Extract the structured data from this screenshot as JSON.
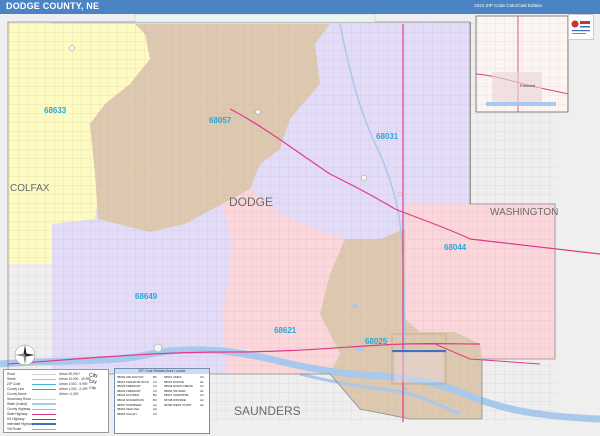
{
  "header": {
    "title": "DODGE COUNTY, NE",
    "edition": "2022 ZIP Code ColorCast Edition"
  },
  "map": {
    "county_label": "DODGE",
    "neighbor_counties": [
      "COLFAX",
      "WASHINGTON",
      "SAUNDERS"
    ],
    "zip_codes": [
      {
        "zip": "68633",
        "color": "#fdfbc2"
      },
      {
        "zip": "68057",
        "color": "#ddc8b0"
      },
      {
        "zip": "68031",
        "color": "#e2dcf8"
      },
      {
        "zip": "68044",
        "color": "#fbd7dc"
      },
      {
        "zip": "68649",
        "color": "#e2dcf8"
      },
      {
        "zip": "68621",
        "color": "#fbd7dc"
      },
      {
        "zip": "68025",
        "color": "#ddc8b0"
      }
    ],
    "colors": {
      "water": "#a9c9ec",
      "neighbor": "#efefef",
      "road": "#f7b2c8",
      "highway": "#e23a87",
      "interstate_bar": "#4070c0",
      "zip_label": "#2aa7d9",
      "county_label": "#6a6a6a",
      "title_bar": "#4a84c4"
    }
  },
  "inset": {
    "town_label": "Fremont"
  },
  "legend": {
    "items": [
      {
        "label": "Road",
        "desc": "Urban 50,000+"
      },
      {
        "label": "Street",
        "desc": "Urban 10,000 - 49,999"
      },
      {
        "label": "ZIP Code",
        "desc": "Urban 2,500 - 9,999"
      },
      {
        "label": "County Line",
        "desc": "Urban 1,000 - 2,499"
      },
      {
        "label": "County Name",
        "desc": "Urban <1,000"
      },
      {
        "label": "Secondary Road",
        "desc": ""
      },
      {
        "label": "Water (Inland)",
        "desc": ""
      },
      {
        "label": "County Highway",
        "desc": ""
      },
      {
        "label": "State Highway",
        "desc": ""
      },
      {
        "label": "US Highway",
        "desc": ""
      },
      {
        "label": "Interstate Highway",
        "desc": ""
      },
      {
        "label": "Toll Route",
        "desc": ""
      }
    ],
    "city_samples": [
      "City",
      "City",
      "City"
    ]
  },
  "zip_table": {
    "header": "ZIP Code Related Area Locator",
    "left": [
      [
        "68002",
        "ARLINGTON",
        "B3"
      ],
      [
        "68015",
        "CEDAR BLUFFS",
        "C3"
      ],
      [
        "68025",
        "FREMONT",
        "C3"
      ],
      [
        "68026",
        "FREMONT",
        "C3"
      ],
      [
        "68031",
        "HOOPER",
        "B2"
      ],
      [
        "68044",
        "NICKERSON",
        "B3"
      ],
      [
        "68057",
        "SCRIBNER",
        "A2"
      ],
      [
        "68063",
        "UEHLING",
        "A3"
      ],
      [
        "68064",
        "VALLEY",
        "C3"
      ]
    ],
    "right": [
      [
        "68621",
        "AMES",
        "C2"
      ],
      [
        "68633",
        "DODGE",
        "A1"
      ],
      [
        "68649",
        "NORTH BEND",
        "C1"
      ],
      [
        "68664",
        "SNYDER",
        "A1"
      ],
      [
        "68667",
        "SURPRISE",
        "C1"
      ],
      [
        "68748",
        "WINSIDE",
        "A2"
      ],
      [
        "68780",
        "WEST POINT",
        "A2"
      ],
      [
        "",
        "",
        ""
      ],
      [
        "",
        "",
        ""
      ]
    ]
  }
}
